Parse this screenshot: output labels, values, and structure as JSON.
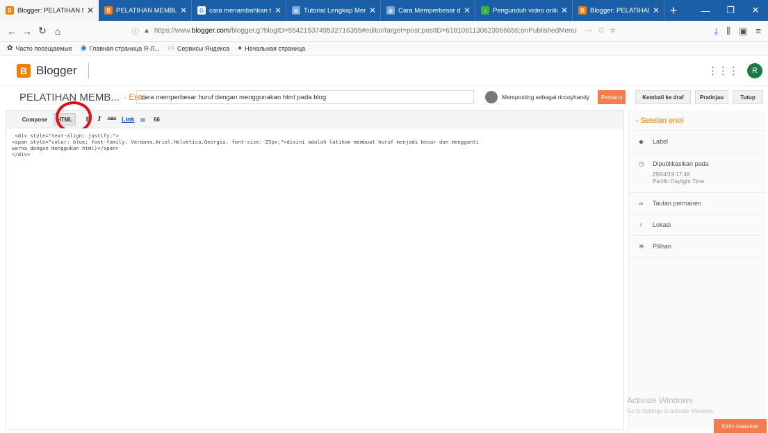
{
  "browser": {
    "tabs": [
      {
        "title": "Blogger: PELATIHAN M",
        "active": true,
        "icon": "blogger-icon",
        "color": "#f57d00"
      },
      {
        "title": "PELATIHAN MEMBUAT",
        "active": false,
        "icon": "blogger-icon",
        "color": "#f57d00"
      },
      {
        "title": "cara menambahkan te",
        "active": false,
        "icon": "google-icon",
        "color": "#ffffff"
      },
      {
        "title": "Tutorial Lengkap Memb",
        "active": false,
        "icon": "globe-icon",
        "color": "#7aa7d8"
      },
      {
        "title": "Cara Memperbesar dan",
        "active": false,
        "icon": "globe-icon",
        "color": "#7aa7d8"
      },
      {
        "title": "Pengunduh video online",
        "active": false,
        "icon": "download-icon",
        "color": "#3cb043"
      },
      {
        "title": "Blogger: PELATIHAN M",
        "active": false,
        "icon": "blogger-icon",
        "color": "#f57d00"
      }
    ],
    "url_prefix": "https://www.",
    "url_domain": "blogger.com",
    "url_rest": "/blogger.g?blogID=5542153749532716355#editor/target=post;postID=6181081130823066656;onPublishedMenu=",
    "bookmarks": [
      {
        "icon": "gear-icon",
        "label": "Часто посещаемые"
      },
      {
        "icon": "globe-icon",
        "label": "Главная страница Я-Л..."
      },
      {
        "icon": "folder-icon",
        "label": "Сервисы Яндекса"
      },
      {
        "icon": "start-icon",
        "label": "Начальная страница"
      }
    ]
  },
  "blogger": {
    "app_name": "Blogger",
    "logo_letter": "B",
    "avatar_letter": "R"
  },
  "post": {
    "blog_name": "PELATIHAN MEMB...",
    "crumb": "· Entri",
    "title": "cara memperbesar huruf dengan menggunakan html pada blog",
    "posting_as": "Memposting sebagai riccoyhandy",
    "publish_label": "Perbarui",
    "revert_label": "Kembali ke draf",
    "preview_label": "Pratinjau",
    "close_label": "Tutup"
  },
  "toolbar": {
    "compose_label": "Compose",
    "html_label": "HTML",
    "bold_label": "B",
    "italic_label": "I",
    "strike_label": "ABC",
    "link_label": "Link",
    "quote_label": "66"
  },
  "editor": {
    "lines": [
      " <div style=\"text-align: justify;\">",
      "<span style=\"color: blue; font-family: Verdana,Arial,Helvetica,Georgia; font-size: 25px;\">disini adalah latihan membuat huruf menjadi besar dan mengganti",
      "warna dengan menggukan html)</span>",
      "</div>"
    ]
  },
  "settings": {
    "title": "- Setelan entri",
    "label_item": "Label",
    "published_item": "Dipublikasikan pada",
    "published_date": "29/04/19 17.48",
    "published_tz": "Pacific Daylight Time",
    "permalink_item": "Tautan permanen",
    "location_item": "Lokasi",
    "options_item": "Pilihan"
  },
  "watermark": {
    "title": "Activate Windows",
    "subtitle": "Go to Settings to activate Windows."
  },
  "comments_button": "Kirim masukan"
}
